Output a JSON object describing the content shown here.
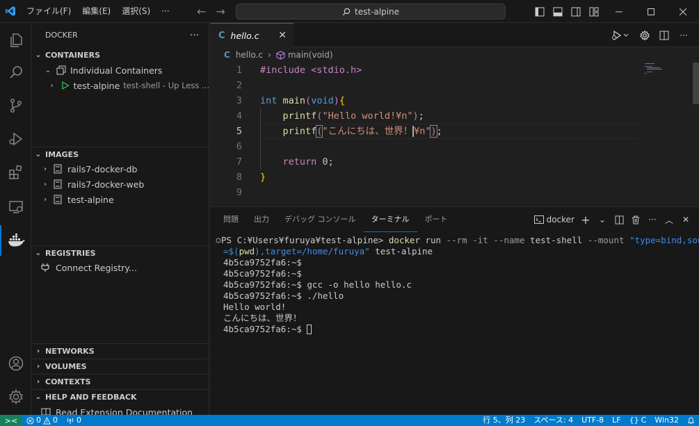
{
  "titlebar": {
    "menus": [
      "ファイル(F)",
      "編集(E)",
      "選択(S)",
      "···"
    ],
    "search": "test-alpine"
  },
  "sidebar": {
    "title": "DOCKER",
    "more": "···",
    "containers_header": "CONTAINERS",
    "group_label": "Individual Containers",
    "container_name": "test-alpine",
    "container_desc": "test-shell - Up Less ...",
    "images_header": "IMAGES",
    "images": [
      "rails7-docker-db",
      "rails7-docker-web",
      "test-alpine"
    ],
    "registries_header": "REGISTRIES",
    "connect_registry": "Connect Registry...",
    "networks_header": "NETWORKS",
    "volumes_header": "VOLUMES",
    "contexts_header": "CONTEXTS",
    "help_header": "HELP AND FEEDBACK",
    "help_item": "Read Extension Documentation"
  },
  "editor": {
    "tab_icon": "C",
    "tab_name": "hello.c",
    "breadcrumb_file": "hello.c",
    "breadcrumb_symbol": "main(void)",
    "line_numbers": [
      "1",
      "2",
      "3",
      "4",
      "5",
      "6",
      "7",
      "8",
      "9"
    ],
    "code": {
      "l1_pp": "#include <stdio.h>",
      "l3_kw": "int",
      "l3_fn": "main",
      "l3_open": "(",
      "l3_void": "void",
      "l3_close": ")",
      "l3_brace": "{",
      "l4_fn": "printf",
      "l4_open": "(",
      "l4_str": "\"Hello world!¥n\"",
      "l4_close": ")",
      "l4_semi": ";",
      "l5_fn": "printf",
      "l5_open": "(",
      "l5_str1": "\"こんにちは、世界！",
      "l5_str2": "¥n\"",
      "l5_close": ")",
      "l5_semi": ";",
      "l7_kw": "return",
      "l7_num": "0",
      "l7_semi": ";",
      "l8_brace": "}"
    }
  },
  "panel": {
    "tabs": [
      "問題",
      "出力",
      "デバッグ コンソール",
      "ターミナル",
      "ポート"
    ],
    "active_tab": "ターミナル",
    "terminal_name": "docker",
    "terminal": {
      "prompt": "PS C:¥Users¥furuya¥test-alpine> ",
      "cmd": "docker",
      "cmd_args1": " run ",
      "flag1": "--rm -it --name",
      "arg_name": " test-shell ",
      "flag2": "--mount",
      "mount_val1": " \"type=bind,source",
      "mount_val2": "=$(",
      "pwd": "pwd",
      "mount_val3": "),target=/home/furuya\"",
      "image": " test-alpine",
      "lines": [
        "4b5ca9752fa6:~$",
        "4b5ca9752fa6:~$",
        "4b5ca9752fa6:~$ gcc -o hello hello.c",
        "4b5ca9752fa6:~$ ./hello",
        "Hello world!",
        "こんにちは、世界！"
      ],
      "last_prompt": "4b5ca9752fa6:~$ "
    }
  },
  "statusbar": {
    "remote": "><",
    "errors": "0",
    "warnings": "0",
    "ports": "0",
    "position": "行 5、列 23",
    "spaces": "スペース: 4",
    "encoding": "UTF-8",
    "eol": "LF",
    "language": "C",
    "platform": "Win32"
  }
}
